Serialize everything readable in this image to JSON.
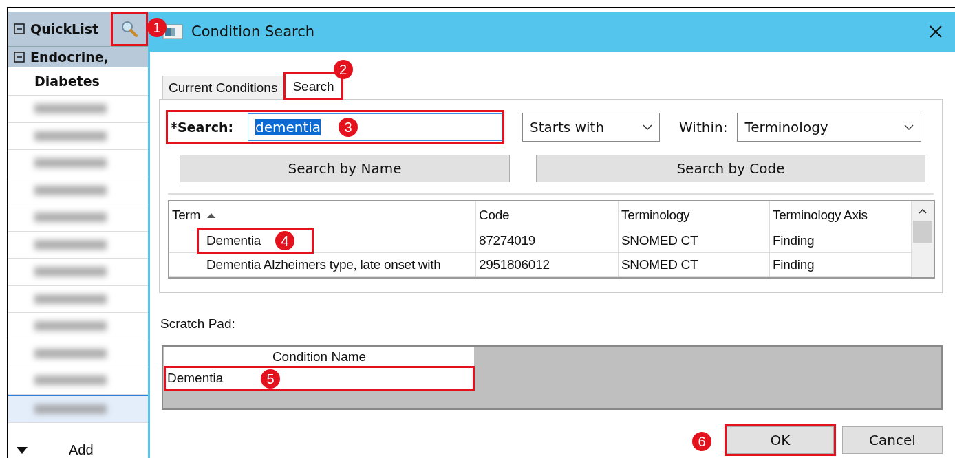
{
  "sidebar": {
    "title": "QuickList",
    "search_callout": "1",
    "group": {
      "label": "Endocrine,",
      "items": [
        {
          "kind": "text",
          "label": "Diabetes",
          "selected": false
        },
        {
          "kind": "blurred",
          "selected": false
        },
        {
          "kind": "blurred",
          "selected": false
        },
        {
          "kind": "blurred",
          "selected": false
        },
        {
          "kind": "blurred",
          "selected": false
        },
        {
          "kind": "blurred",
          "selected": false
        },
        {
          "kind": "blurred",
          "selected": false
        },
        {
          "kind": "blurred",
          "selected": false
        },
        {
          "kind": "blurred",
          "selected": false
        },
        {
          "kind": "blurred",
          "selected": false
        },
        {
          "kind": "blurred",
          "selected": false
        },
        {
          "kind": "blurred",
          "selected": false
        },
        {
          "kind": "blurred",
          "selected": true
        }
      ]
    },
    "add_label": "Add"
  },
  "dialog": {
    "title": "Condition Search",
    "tabs": [
      {
        "label": "Current Conditions",
        "selected": false
      },
      {
        "label": "Search",
        "selected": true,
        "callout": "2"
      }
    ],
    "search": {
      "label": "*Search:",
      "value": "dementia",
      "callout": "3"
    },
    "match": {
      "value": "Starts with"
    },
    "within": {
      "label": "Within:",
      "value": "Terminology"
    },
    "buttons": [
      "Search by Name",
      "Search by Code"
    ],
    "results": {
      "columns": [
        {
          "label": "Term",
          "sorted": true
        },
        {
          "label": "Code",
          "sorted": false
        },
        {
          "label": "Terminology",
          "sorted": false
        },
        {
          "label": "Terminology Axis",
          "sorted": false
        }
      ],
      "rows": [
        {
          "cells": [
            "Dementia",
            "87274019",
            "SNOMED CT",
            "Finding"
          ],
          "callout": "4"
        },
        {
          "cells": [
            "Dementia Alzheimers type, late onset with",
            "2951806012",
            "SNOMED CT",
            "Finding"
          ]
        }
      ]
    },
    "scratch_pad": {
      "label": "Scratch Pad:",
      "column": "Condition Name",
      "rows": [
        {
          "cells": [
            "Dementia"
          ],
          "callout": "5"
        }
      ]
    },
    "footer_buttons": [
      {
        "label": "OK",
        "callout": "6"
      },
      {
        "label": "Cancel"
      }
    ]
  }
}
